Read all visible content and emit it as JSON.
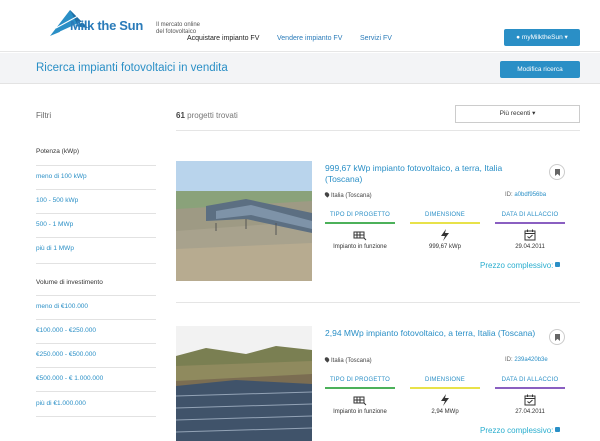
{
  "header": {
    "logo_text": "Milk the Sun",
    "tagline": "Il mercato online del fotovoltaico",
    "nav": [
      "Acquistare impianto FV",
      "Vendere impianto FV",
      "Servizi FV"
    ],
    "user_button": "myMilktheSun ▾"
  },
  "subheader": {
    "title": "Ricerca impianti fotovoltaici in vendita",
    "modify_button": "Modifica ricerca"
  },
  "sidebar": {
    "title": "Filtri",
    "power_heading": "Potenza (kWp)",
    "power_items": [
      "meno di 100 kWp",
      "100 - 500 kWp",
      "500 - 1 MWp",
      "più di 1 MWp"
    ],
    "investment_heading": "Volume di investimento",
    "investment_items": [
      "meno di €100.000",
      "€100.000 - €250.000",
      "€250.000 - €500.000",
      "€500.000 - € 1.000.000",
      "più di €1.000.000"
    ]
  },
  "results": {
    "count": "61",
    "count_label": "progetti trovati",
    "sort": "Più recenti ▾"
  },
  "columns": {
    "type": "TIPO DI PROGETTO",
    "size": "DIMENSIONE",
    "date": "DATA DI ALLACCIO"
  },
  "colors": {
    "accent": "#2a8fc6",
    "type_bar": "#4cb15a",
    "size_bar": "#e8e24a",
    "date_bar": "#8a5fc1"
  },
  "listings": [
    {
      "title": "999,67 kWp impianto fotovoltaico, a terra, Italia (Toscana)",
      "location": "Italia (Toscana)",
      "id_label": "ID:",
      "id": "a0bdf956ba",
      "type": "Impianto in funzione",
      "size": "999,67 kWp",
      "date": "29.04.2011",
      "price": "Prezzo complessivo:"
    },
    {
      "title": "2,94 MWp impianto fotovoltaico, a terra, Italia (Toscana)",
      "location": "Italia (Toscana)",
      "id_label": "ID:",
      "id": "239a420b3e",
      "type": "Impianto in funzione",
      "size": "2,94 MWp",
      "date": "27.04.2011",
      "price": "Prezzo complessivo:"
    }
  ]
}
